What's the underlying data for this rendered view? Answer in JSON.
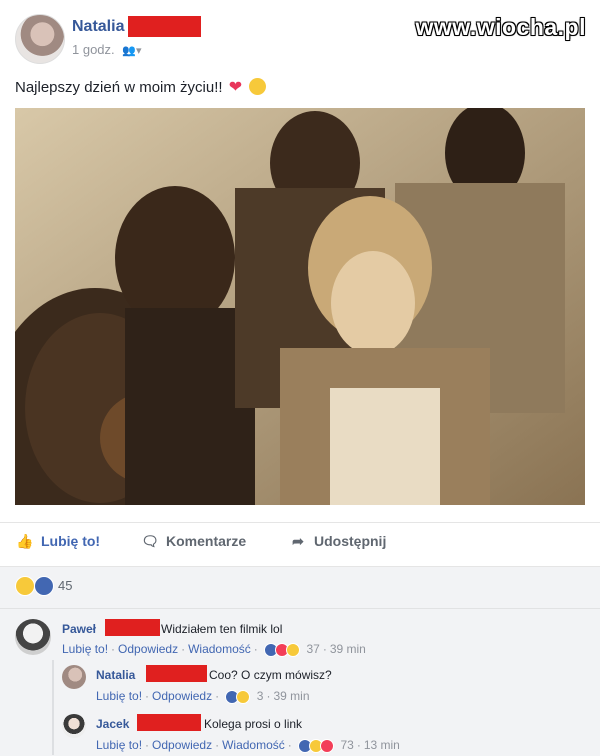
{
  "post": {
    "author": "Natalia",
    "time": "1 godz.",
    "audience_icon": "friends-icon",
    "text": "Najlepszy dzień w moim życiu!!",
    "emoji": [
      "heart-icon",
      "laughing-emoji-icon"
    ]
  },
  "watermark": "www.wiocha.pl",
  "actions": {
    "like": "Lubię to!",
    "comment": "Komentarze",
    "share": "Udostępnij"
  },
  "reactions": {
    "count": "45",
    "icons": [
      "haha-reaction-icon",
      "like-reaction-icon"
    ]
  },
  "comments": [
    {
      "author": "Paweł",
      "text": "Widziałem ten filmik lol",
      "like": "Lubię to!",
      "reply": "Odpowiedz",
      "message": "Wiadomość",
      "reaction_count": "37",
      "time": "39 min"
    },
    {
      "author": "Natalia",
      "text": "Coo? O czym mówisz?",
      "like": "Lubię to!",
      "reply": "Odpowiedz",
      "reaction_count": "3",
      "time": "39 min"
    },
    {
      "author": "Jacek",
      "text": "Kolega prosi o link",
      "like": "Lubię to!",
      "reply": "Odpowiedz",
      "message": "Wiadomość",
      "reaction_count": "73",
      "time": "13 min"
    }
  ],
  "colors": {
    "link_blue": "#365899",
    "action_blue": "#4267b2",
    "redaction_red": "#e0201f",
    "grey_text": "#90949c",
    "comment_bg": "#f2f3f5"
  }
}
